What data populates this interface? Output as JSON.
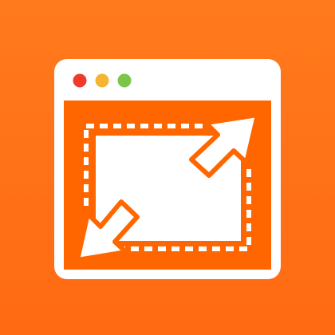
{
  "app_icon": {
    "name": "window-resize-app-icon",
    "colors": {
      "background_top": "#FF7A1C",
      "background_bottom": "#FF6A12",
      "window_frame": "#FFFFFF",
      "window_body": "#FF6600",
      "content_fill": "#FFFFFF",
      "arrow_fill": "#FFFFFF",
      "arrow_outline": "#FF6600",
      "dot_close": "#EE3B2B",
      "dot_minimize": "#F5B431",
      "dot_maximize": "#7CC44A"
    },
    "window_controls": [
      {
        "name": "close-dot",
        "icon": "close-dot-icon"
      },
      {
        "name": "minimize-dot",
        "icon": "minimize-dot-icon"
      },
      {
        "name": "maximize-dot",
        "icon": "maximize-dot-icon"
      }
    ],
    "icons": [
      "dashed-selection-frame-icon",
      "resize-arrow-up-right-icon",
      "resize-arrow-down-left-icon"
    ]
  }
}
